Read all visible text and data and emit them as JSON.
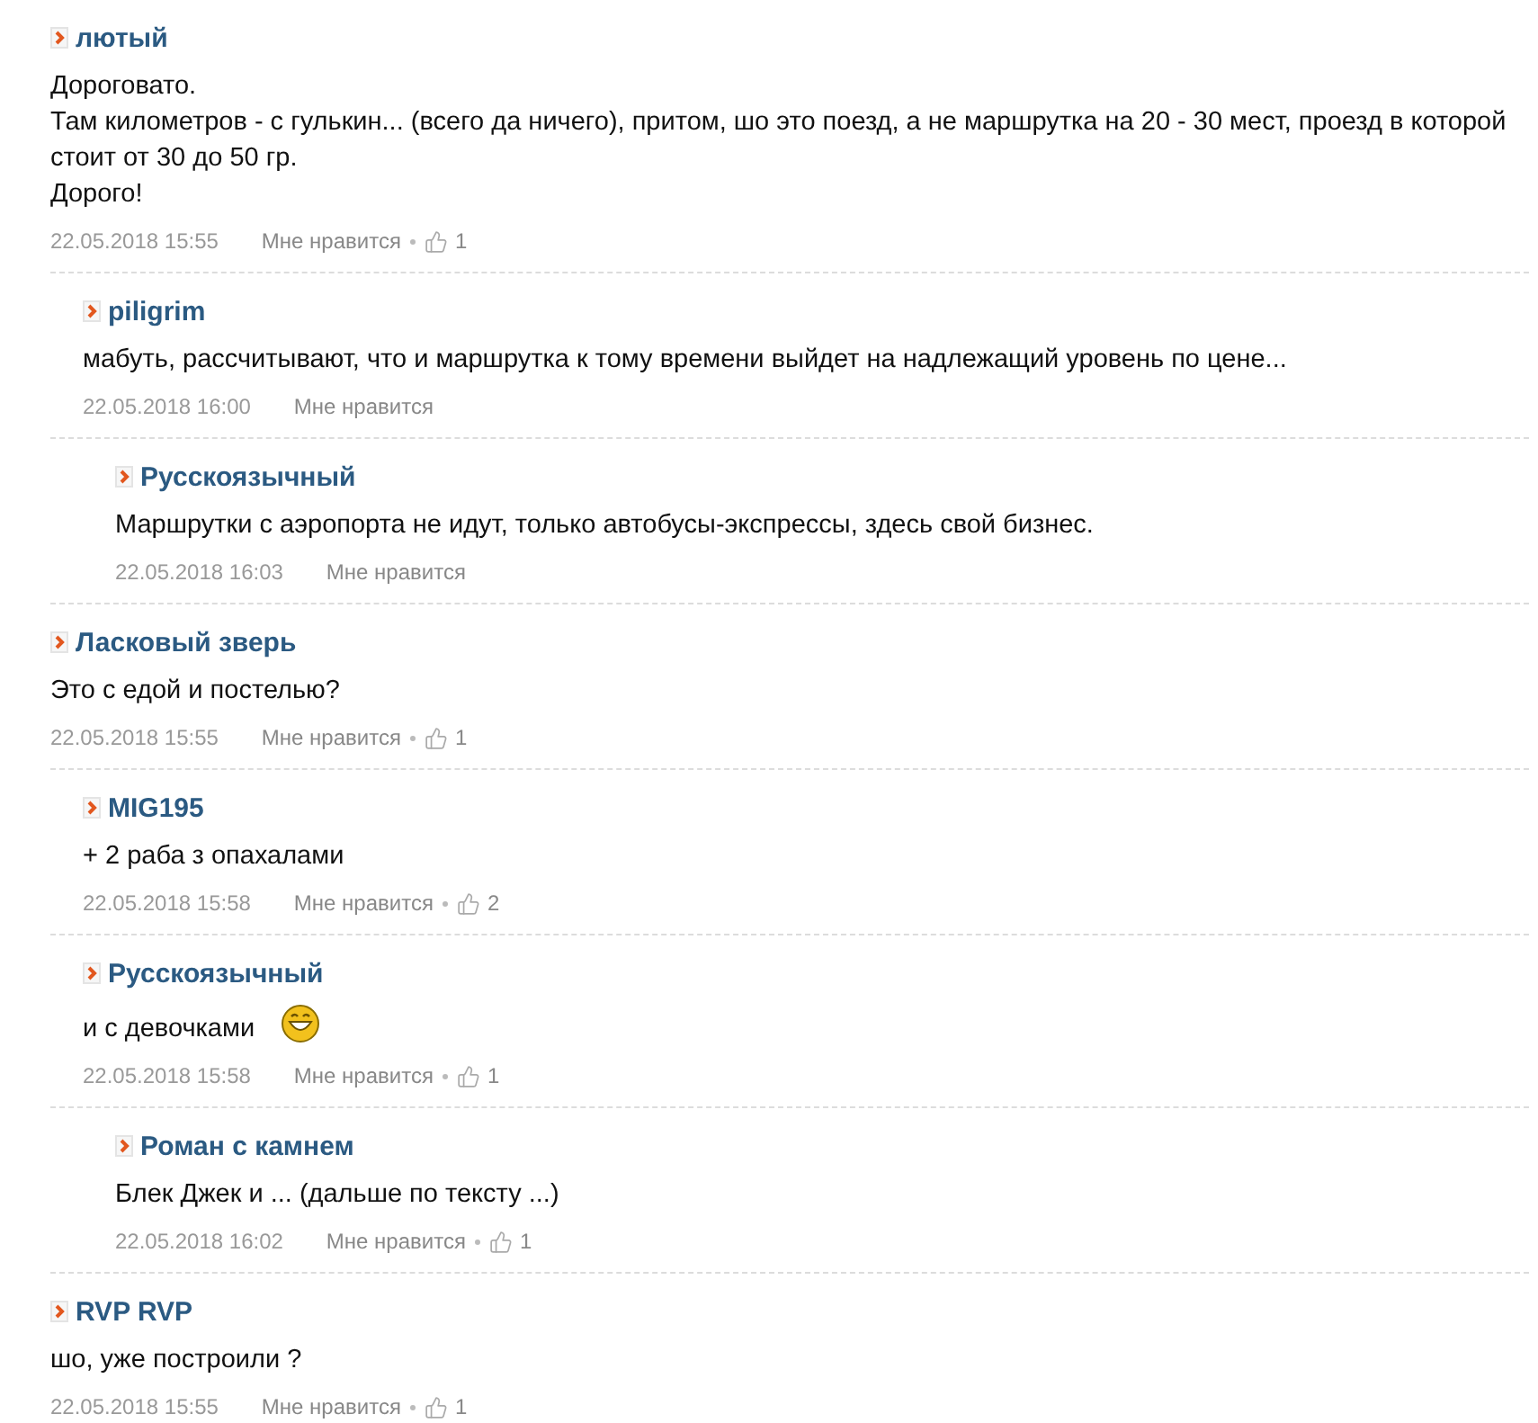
{
  "comments": [
    {
      "author": "лютый",
      "text": [
        "Дороговато.",
        "Там километров - с гулькин... (всего да ничего), притом, шо это поезд, а не маршрутка на 20 - 30 мест, проезд в которой стоит от 30 до 50 гр.",
        "Дорого!"
      ],
      "date": "22.05.2018 15:55",
      "like_label": "Мне нравится",
      "likes": "1",
      "children": [
        {
          "author": "piligrim",
          "text": [
            "мабуть, рассчитывают, что и маршрутка к тому времени выйдет на надлежащий уровень по цене..."
          ],
          "date": "22.05.2018 16:00",
          "like_label": "Мне нравится",
          "children": [
            {
              "author": "Русскоязычный",
              "text": [
                "Маршрутки с аэропорта не идут, только автобусы-экспрессы, здесь свой бизнес."
              ],
              "date": "22.05.2018 16:03",
              "like_label": "Мне нравится"
            }
          ]
        }
      ]
    },
    {
      "author": "Ласковый зверь",
      "text": [
        "Это с едой и постелью?"
      ],
      "date": "22.05.2018 15:55",
      "like_label": "Мне нравится",
      "likes": "1",
      "children": [
        {
          "author": "MIG195",
          "text": [
            "+ 2 раба з опахалами"
          ],
          "date": "22.05.2018 15:58",
          "like_label": "Мне нравится",
          "likes": "2"
        },
        {
          "author": "Русскоязычный",
          "text": [
            "и с девочками"
          ],
          "smiley": true,
          "date": "22.05.2018 15:58",
          "like_label": "Мне нравится",
          "likes": "1",
          "children": [
            {
              "author": "Роман с камнем",
              "text": [
                "Блек Джек и ... (дальше по тексту ...)"
              ],
              "date": "22.05.2018 16:02",
              "like_label": "Мне нравится",
              "likes": "1"
            }
          ]
        }
      ]
    },
    {
      "author": "RVP RVP",
      "text": [
        "шо, уже построили ?"
      ],
      "date": "22.05.2018 15:55",
      "like_label": "Мне нравится",
      "likes": "1"
    }
  ]
}
